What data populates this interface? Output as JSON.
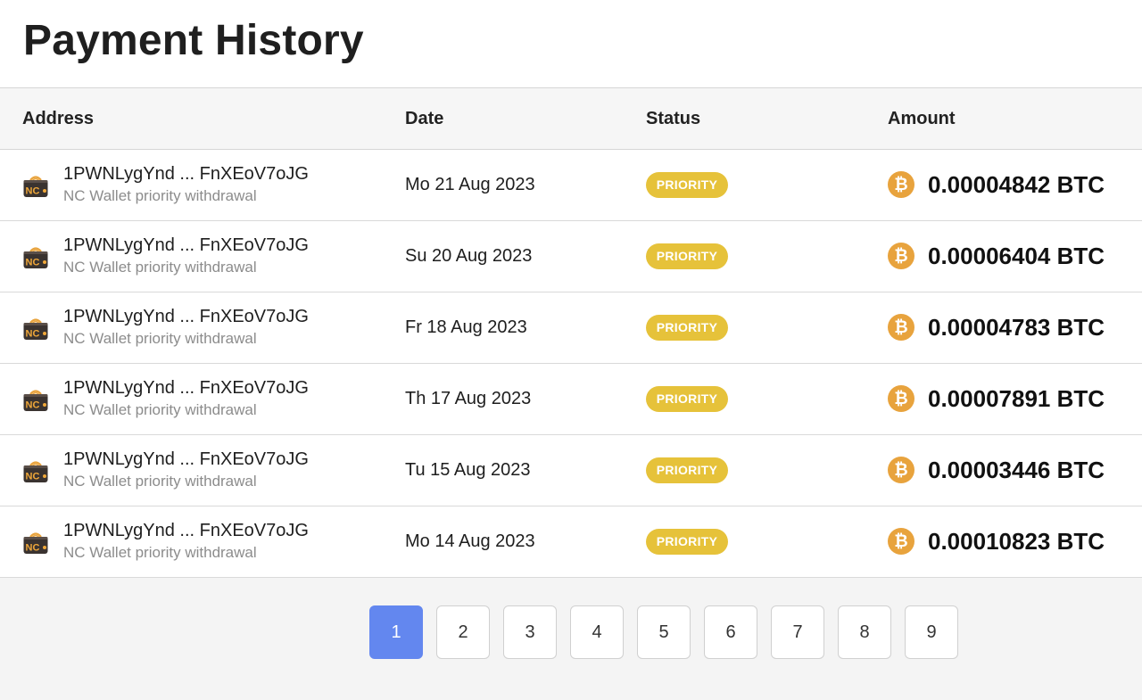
{
  "page": {
    "title": "Payment History"
  },
  "table": {
    "headers": {
      "address": "Address",
      "date": "Date",
      "status": "Status",
      "amount": "Amount"
    },
    "rows": [
      {
        "address": "1PWNLygYnd ... FnXEoV7oJG",
        "description": "NC Wallet priority withdrawal",
        "date": "Mo 21 Aug 2023",
        "status": "PRIORITY",
        "amount": "0.00004842 BTC"
      },
      {
        "address": "1PWNLygYnd ... FnXEoV7oJG",
        "description": "NC Wallet priority withdrawal",
        "date": "Su 20 Aug 2023",
        "status": "PRIORITY",
        "amount": "0.00006404 BTC"
      },
      {
        "address": "1PWNLygYnd ... FnXEoV7oJG",
        "description": "NC Wallet priority withdrawal",
        "date": "Fr 18 Aug 2023",
        "status": "PRIORITY",
        "amount": "0.00004783 BTC"
      },
      {
        "address": "1PWNLygYnd ... FnXEoV7oJG",
        "description": "NC Wallet priority withdrawal",
        "date": "Th 17 Aug 2023",
        "status": "PRIORITY",
        "amount": "0.00007891 BTC"
      },
      {
        "address": "1PWNLygYnd ... FnXEoV7oJG",
        "description": "NC Wallet priority withdrawal",
        "date": "Tu 15 Aug 2023",
        "status": "PRIORITY",
        "amount": "0.00003446 BTC"
      },
      {
        "address": "1PWNLygYnd ... FnXEoV7oJG",
        "description": "NC Wallet priority withdrawal",
        "date": "Mo 14 Aug 2023",
        "status": "PRIORITY",
        "amount": "0.00010823 BTC"
      }
    ]
  },
  "icons": {
    "wallet": "nc-wallet-icon",
    "coin": "bitcoin-icon",
    "wallet_label": "NC",
    "coin_glyph": "₿"
  },
  "colors": {
    "accent": "#6387ef",
    "priority_badge": "#e6c23a",
    "bitcoin": "#e8a33d"
  },
  "pagination": {
    "pages": [
      "1",
      "2",
      "3",
      "4",
      "5",
      "6",
      "7",
      "8",
      "9"
    ],
    "current": "1"
  }
}
